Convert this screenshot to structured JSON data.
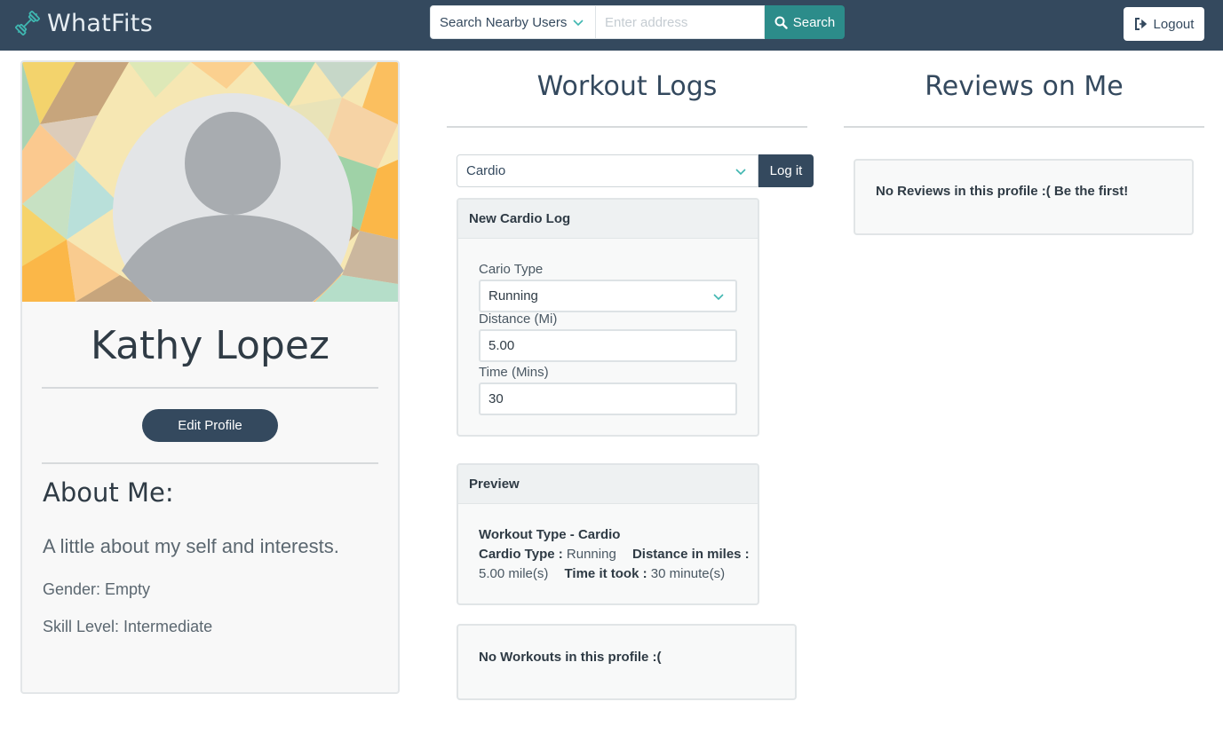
{
  "brand": {
    "name": "WhatFits",
    "icon": "dumbbell-icon"
  },
  "navbar": {
    "search_scope": "Search Nearby Users",
    "address_placeholder": "Enter address",
    "search_label": "Search",
    "logout_label": "Logout"
  },
  "profile": {
    "name": "Kathy Lopez",
    "edit_label": "Edit Profile",
    "about_title": "About Me:",
    "about_text": "A little about my self and interests.",
    "gender": "Gender: Empty",
    "skill": "Skill Level: Intermediate"
  },
  "workouts": {
    "title": "Workout Logs",
    "type_selected": "Cardio",
    "log_label": "Log it",
    "form": {
      "header": "New Cardio Log",
      "type_label": "Cario Type",
      "type_value": "Running",
      "distance_label": "Distance (Mi)",
      "distance_value": "5.00",
      "time_label": "Time (Mins)",
      "time_value": "30"
    },
    "preview": {
      "header": "Preview",
      "workout_type": "Workout Type - Cardio",
      "cardio_type_label": "Cardio Type :",
      "cardio_type_value": "Running",
      "distance_label": "Distance in miles :",
      "distance_value": "5.00 mile(s)",
      "time_label": "Time it took :",
      "time_value": "30 minute(s)"
    },
    "empty_text": "No Workouts in this profile :("
  },
  "reviews": {
    "title": "Reviews on Me",
    "empty_text": "No Reviews in this profile :( Be the first!"
  },
  "colors": {
    "navbar": "#34495e",
    "accent": "#2c8c8a",
    "primary_button": "#34495e"
  }
}
